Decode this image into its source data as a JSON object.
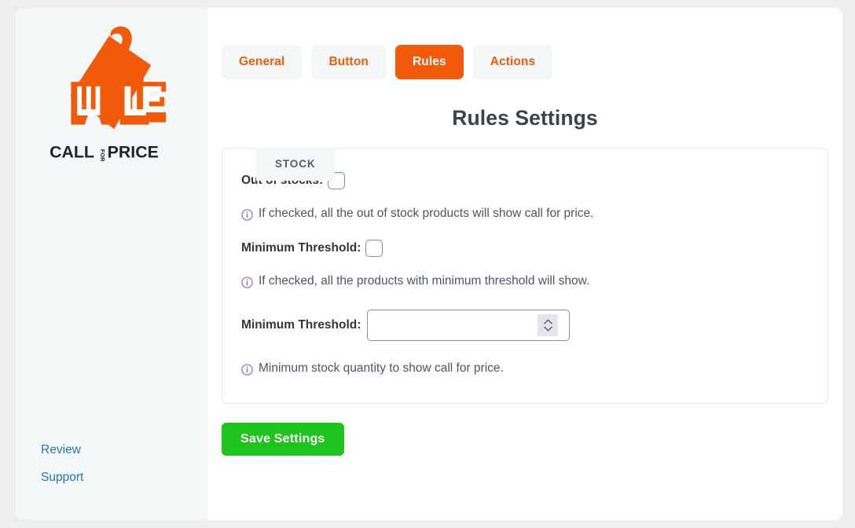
{
  "window": {
    "page_background": "#eeeeee",
    "card_background": "#ffffff"
  },
  "sidebar": {
    "background": "#f4f7f8",
    "logo": {
      "icon_name": "call-for-price-tag-logo",
      "wordmark_main": "CALL",
      "wordmark_mid": "FOR",
      "wordmark_end": "PRICE",
      "brand_color": "#f15a0a",
      "wordmark_color": "#1f2327"
    },
    "links": [
      {
        "label": "Review",
        "name": "sidebar-link-review"
      },
      {
        "label": "Support",
        "name": "sidebar-link-support"
      }
    ],
    "link_color": "#2e73b4"
  },
  "tabs": {
    "items": [
      {
        "label": "General",
        "active": false
      },
      {
        "label": "Button",
        "active": false
      },
      {
        "label": "Rules",
        "active": true
      },
      {
        "label": "Actions",
        "active": false
      }
    ],
    "inactive_bg": "#f4f7f8",
    "inactive_color": "#ef5b09",
    "active_bg": "#f15a0a",
    "active_color": "#ffffff"
  },
  "main": {
    "title": "Rules Settings",
    "title_color": "#3c434a",
    "panel": {
      "tab_label": "STOCK",
      "tab_bg": "#f4f7f8",
      "tab_color": "#555d66",
      "border_color": "#e6eaec",
      "fields": {
        "out_of_stocks": {
          "label": "Out of stocks:",
          "checkbox_name": "out-of-stocks-checkbox",
          "checked": false,
          "hint": "If checked, all the out of stock products will show call for price.",
          "hint_icon": "info-circle-icon"
        },
        "minimum_threshold_toggle": {
          "label": "Minimum Threshold:",
          "checkbox_name": "minimum-threshold-checkbox",
          "checked": false,
          "hint": "If checked, all the products with minimum threshold will show.",
          "hint_icon": "info-circle-icon"
        },
        "minimum_threshold_value": {
          "label": "Minimum Threshold:",
          "input_name": "minimum-threshold-number-input",
          "value": "",
          "placeholder": "",
          "spinner_icon": "up-down-chevron-spinner-icon",
          "hint": "Minimum stock quantity to show call for price.",
          "hint_icon": "info-circle-icon"
        }
      }
    }
  },
  "footer": {
    "save_label": "Save Settings",
    "save_bg": "#1ec31e",
    "save_color": "#ffffff"
  },
  "colors": {
    "info_icon": "#7b75c8",
    "hint_text": "#4e5661",
    "label_text": "#32373c",
    "checkbox_border": "#8c8f94"
  }
}
